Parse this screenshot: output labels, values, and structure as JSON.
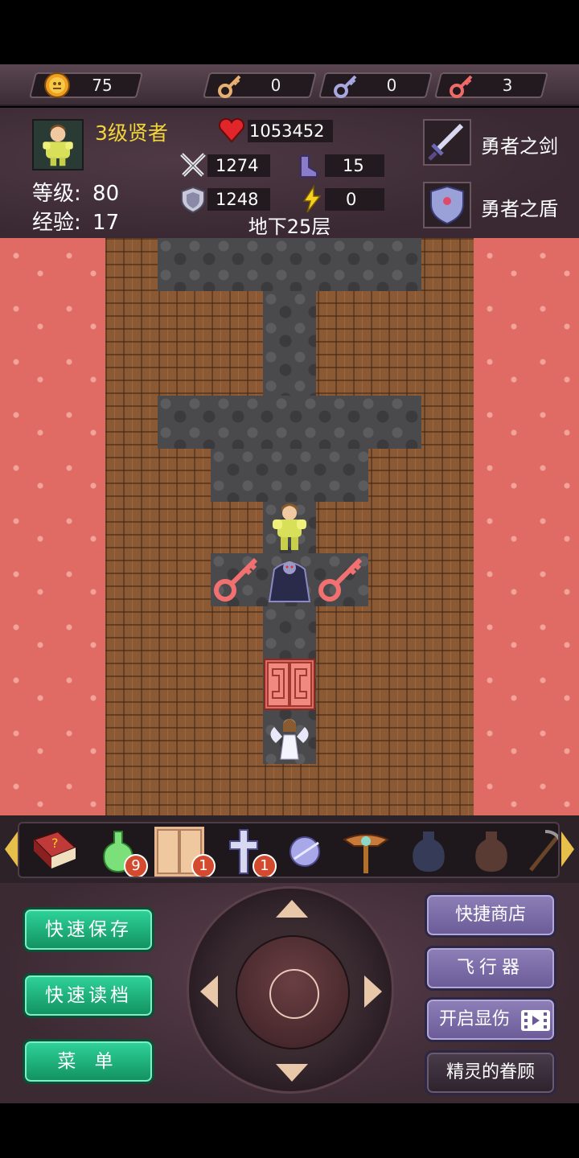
{
  "resources": {
    "gold": "75",
    "yellow_keys": "0",
    "blue_keys": "0",
    "red_keys": "3"
  },
  "hero": {
    "title": "3级贤者",
    "level_label": "等级:",
    "level_value": "80",
    "exp_label": "经验:",
    "exp_value": "17",
    "hp": "1053452",
    "attack": "1274",
    "defense": "1248",
    "magic_defense": "15",
    "energy": "0"
  },
  "floor": "地下25层",
  "equipment": {
    "weapon": "勇者之剑",
    "shield": "勇者之盾"
  },
  "items": [
    {
      "icon": "red-book-icon",
      "count": ""
    },
    {
      "icon": "green-potion-icon",
      "count": "9"
    },
    {
      "icon": "door-tile-icon",
      "count": "1"
    },
    {
      "icon": "cross-icon",
      "count": "1"
    },
    {
      "icon": "orb-icon",
      "count": ""
    },
    {
      "icon": "winged-staff-icon",
      "count": ""
    },
    {
      "icon": "dark-vase-icon",
      "count": ""
    },
    {
      "icon": "brown-vase-icon",
      "count": ""
    },
    {
      "icon": "pickaxe-icon",
      "count": ""
    }
  ],
  "buttons": {
    "quick_save": "快速保存",
    "quick_load": "快速读档",
    "menu": "菜 单",
    "quick_shop": "快捷商店",
    "flyer": "飞行器",
    "show_damage": "开启显伤",
    "fairy_blessing": "精灵的眷顾"
  },
  "colors": {
    "lava": "#e06a64",
    "brick": "#8b5a35",
    "stone": "#4a4a4c",
    "green_button": "#1fb37c",
    "purple_button": "#7d6ea8",
    "title_gold": "#f1d53a"
  }
}
